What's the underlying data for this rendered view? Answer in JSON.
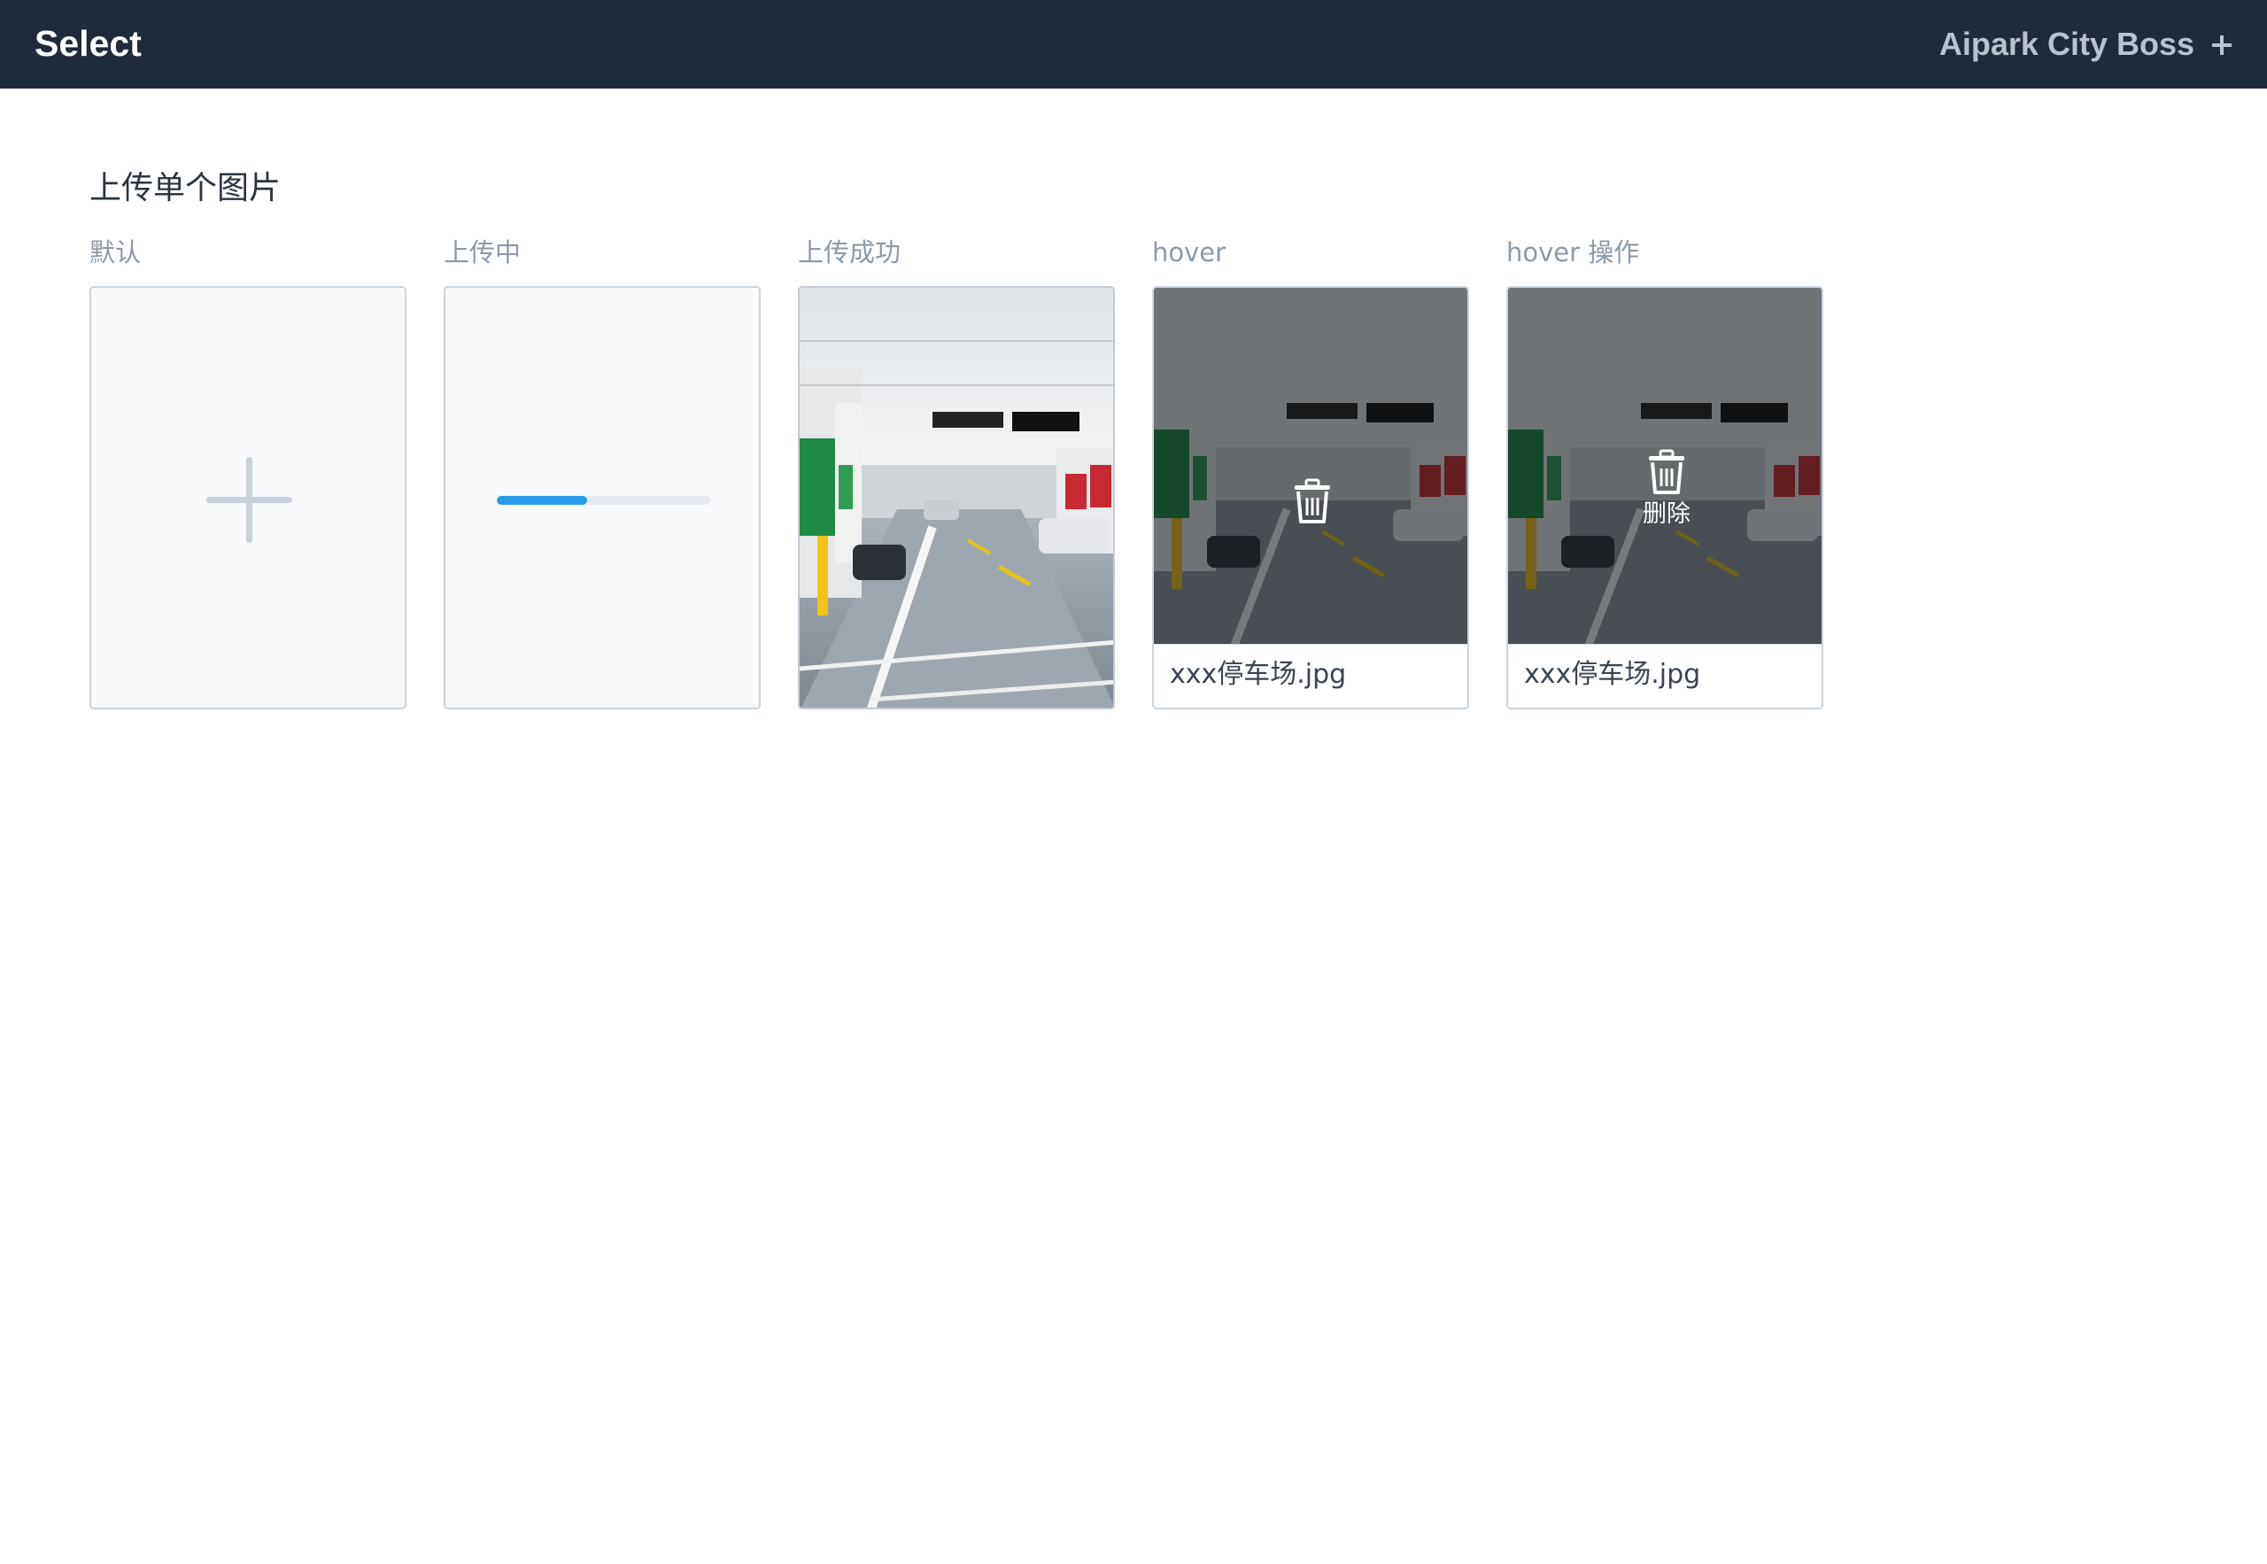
{
  "header": {
    "title": "Select",
    "right_label": "Aipark City Boss",
    "right_icon": "plus-icon"
  },
  "section": {
    "title": "上传单个图片"
  },
  "columns": [
    {
      "label": "默认"
    },
    {
      "label": "上传中",
      "progress_percent": 42
    },
    {
      "label": "上传成功"
    },
    {
      "label": "hover",
      "filename": "xxx停车场.jpg"
    },
    {
      "label": "hover 操作",
      "filename": "xxx停车场.jpg",
      "action_label": "删除"
    }
  ],
  "colors": {
    "header_bg": "#1f2a3a",
    "progress_accent": "#2a9be8",
    "border": "#ccd4de"
  }
}
